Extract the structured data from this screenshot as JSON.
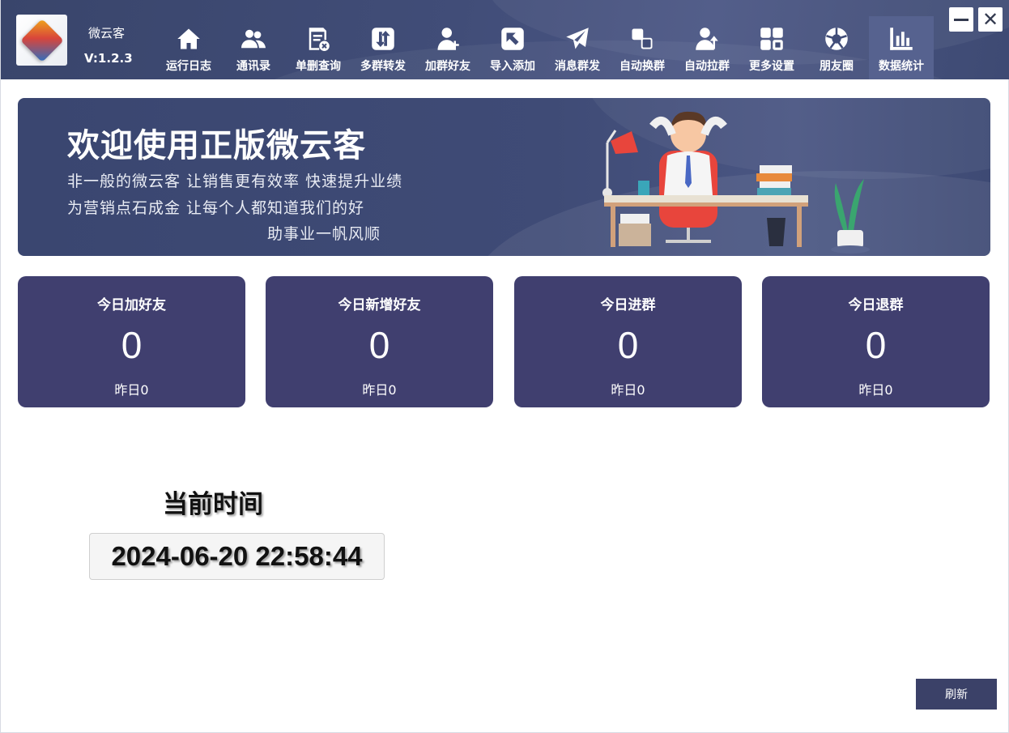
{
  "app": {
    "name": "微云客",
    "version": "V:1.2.3"
  },
  "nav": [
    {
      "label": "运行日志",
      "icon": "home-icon"
    },
    {
      "label": "通讯录",
      "icon": "contacts-icon"
    },
    {
      "label": "单删查询",
      "icon": "document-delete-icon"
    },
    {
      "label": "多群转发",
      "icon": "transfer-arrows-icon"
    },
    {
      "label": "加群好友",
      "icon": "add-user-icon"
    },
    {
      "label": "导入添加",
      "icon": "import-arrow-icon"
    },
    {
      "label": "消息群发",
      "icon": "paper-plane-icon"
    },
    {
      "label": "自动换群",
      "icon": "switch-group-icon"
    },
    {
      "label": "自动拉群",
      "icon": "pull-user-icon"
    },
    {
      "label": "更多设置",
      "icon": "grid-settings-icon"
    },
    {
      "label": "朋友圈",
      "icon": "aperture-icon"
    },
    {
      "label": "数据统计",
      "icon": "bar-chart-icon",
      "active": true
    }
  ],
  "banner": {
    "title": "欢迎使用正版微云客",
    "line1": "非一般的微云客  让销售更有效率  快速提升业绩",
    "line2": "为营销点石成金  让每个人都知道我们的好",
    "line3": "助事业一帆风顺"
  },
  "stats": [
    {
      "title": "今日加好友",
      "value": "0",
      "yesterday": "昨日0"
    },
    {
      "title": "今日新增好友",
      "value": "0",
      "yesterday": "昨日0"
    },
    {
      "title": "今日进群",
      "value": "0",
      "yesterday": "昨日0"
    },
    {
      "title": "今日退群",
      "value": "0",
      "yesterday": "昨日0"
    }
  ],
  "time": {
    "label": "当前时间",
    "value": "2024-06-20 22:58:44"
  },
  "refresh_label": "刷新",
  "colors": {
    "topbar": "#414d78",
    "card": "#403f6f",
    "active_nav": "#56628f",
    "refresh": "#3b4168"
  }
}
